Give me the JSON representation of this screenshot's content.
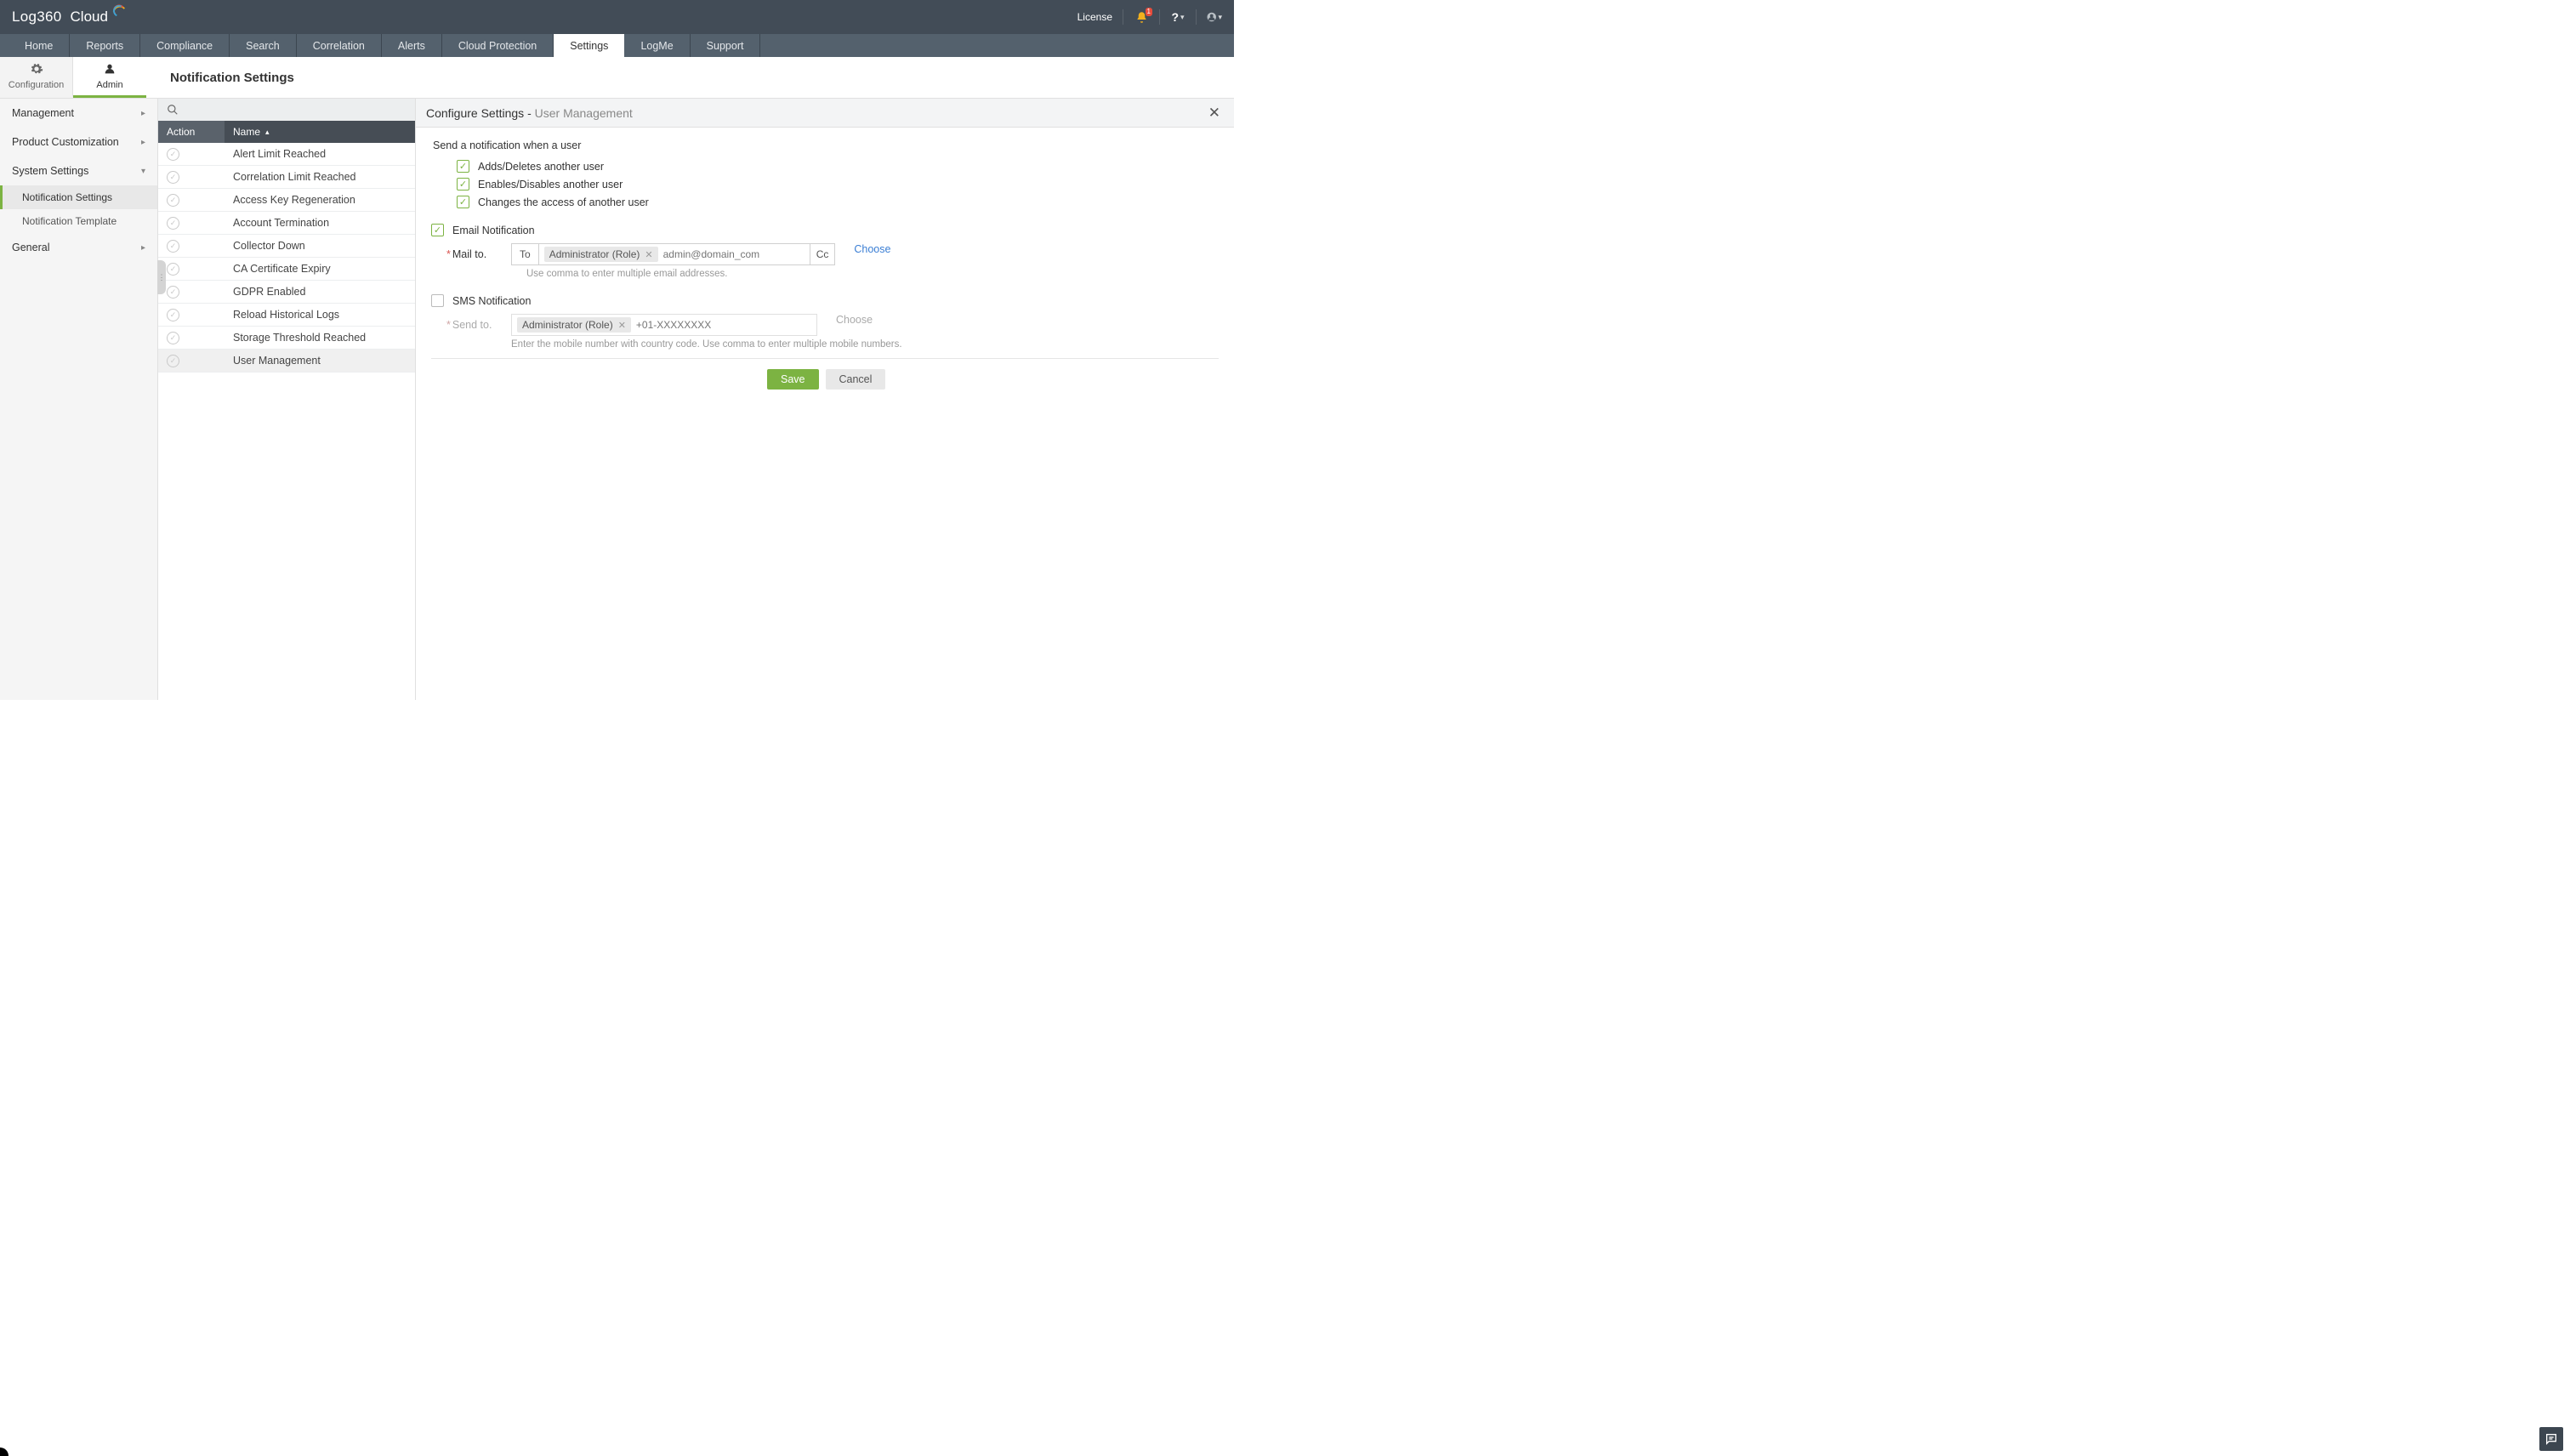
{
  "brand": {
    "name": "Log360",
    "suffix": "Cloud"
  },
  "header": {
    "license": "License",
    "notif_count": "1"
  },
  "tabs": [
    "Home",
    "Reports",
    "Compliance",
    "Search",
    "Correlation",
    "Alerts",
    "Cloud Protection",
    "Settings",
    "LogMe",
    "Support"
  ],
  "active_tab": "Settings",
  "subtabs": {
    "config": "Configuration",
    "admin": "Admin"
  },
  "page_title": "Notification Settings",
  "sidebar": {
    "sections": [
      {
        "label": "Management",
        "expanded": false
      },
      {
        "label": "Product Customization",
        "expanded": false
      },
      {
        "label": "System Settings",
        "expanded": true,
        "items": [
          "Notification Settings",
          "Notification Template"
        ],
        "active": "Notification Settings"
      },
      {
        "label": "General",
        "expanded": false
      }
    ]
  },
  "list": {
    "action_header": "Action",
    "name_header": "Name",
    "rows": [
      "Alert Limit Reached",
      "Correlation Limit Reached",
      "Access Key Regeneration",
      "Account Termination",
      "Collector Down",
      "CA Certificate Expiry",
      "GDPR Enabled",
      "Reload Historical Logs",
      "Storage Threshold Reached",
      "User Management"
    ],
    "selected": "User Management"
  },
  "detail": {
    "title_prefix": "Configure Settings - ",
    "title_item": "User Management",
    "intro": "Send a notification when a user",
    "conditions": [
      "Adds/Deletes another user",
      "Enables/Disables another user",
      "Changes the access of another user"
    ],
    "email_section": "Email Notification",
    "mail_to_label": "Mail to.",
    "to_label": "To",
    "cc_label": "Cc",
    "admin_tag": "Administrator (Role)",
    "email_placeholder": "admin@domain_com",
    "choose": "Choose",
    "email_hint": "Use comma to enter multiple email addresses.",
    "sms_section": "SMS Notification",
    "send_to_label": "Send to.",
    "sms_placeholder": "+01-XXXXXXXX",
    "sms_hint": "Enter the mobile number with country code. Use comma to enter multiple mobile numbers.",
    "save": "Save",
    "cancel": "Cancel"
  }
}
